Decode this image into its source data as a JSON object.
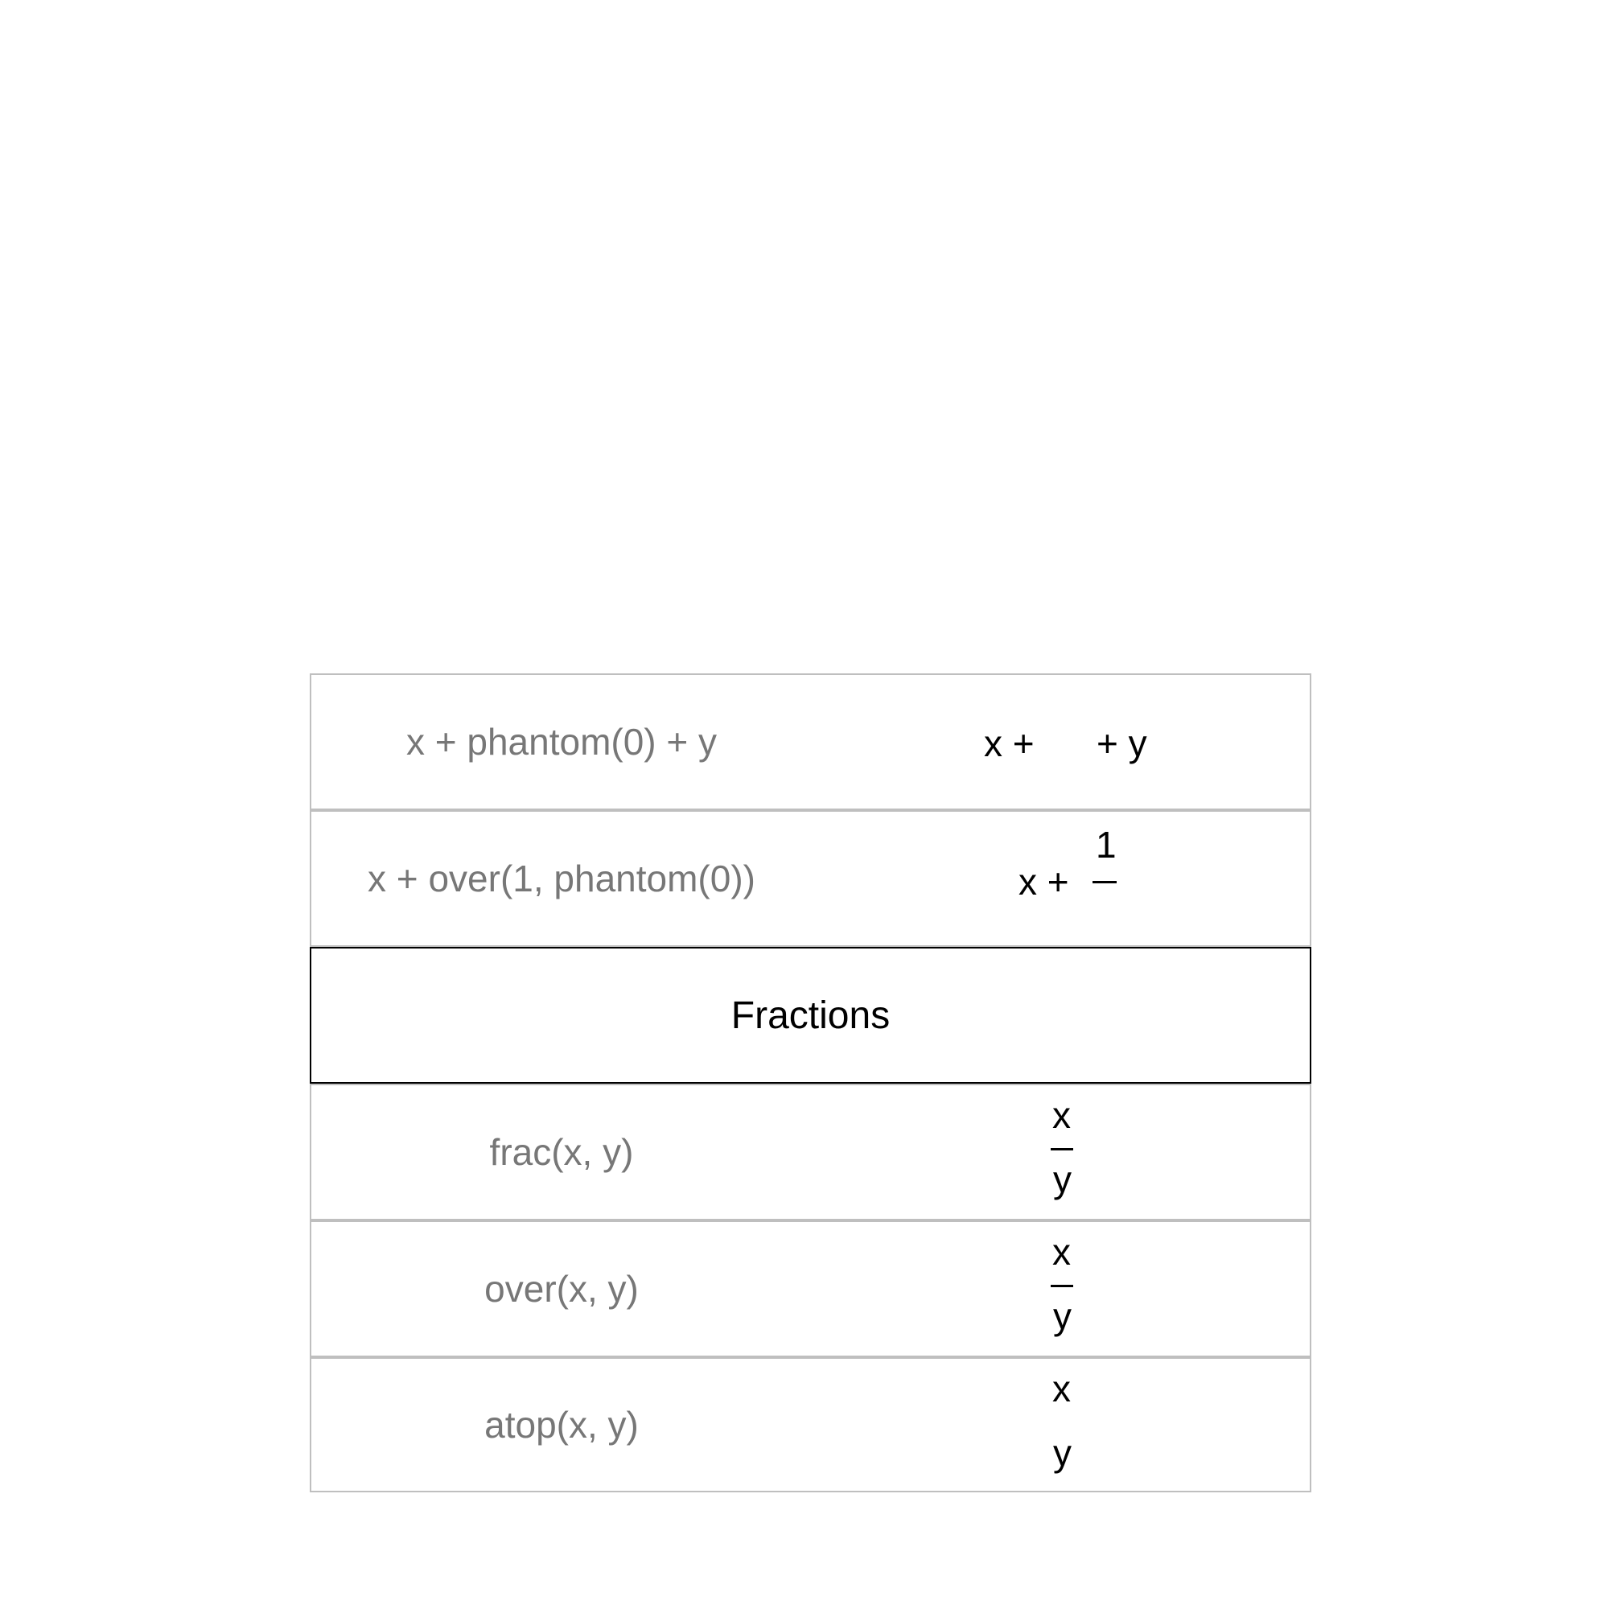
{
  "rows": [
    {
      "code": "x + phantom(0) + y",
      "rendered": {
        "left": "x +",
        "right": "+ y"
      }
    },
    {
      "code": "x + over(1, phantom(0))",
      "rendered": {
        "base": "x +",
        "numerator": "1"
      }
    },
    {
      "header": "Fractions"
    },
    {
      "code": "frac(x, y)",
      "rendered": {
        "numerator": "x",
        "denominator": "y"
      }
    },
    {
      "code": "over(x, y)",
      "rendered": {
        "numerator": "x",
        "denominator": "y"
      }
    },
    {
      "code": "atop(x, y)",
      "rendered": {
        "top": "x",
        "bottom": "y"
      }
    }
  ]
}
